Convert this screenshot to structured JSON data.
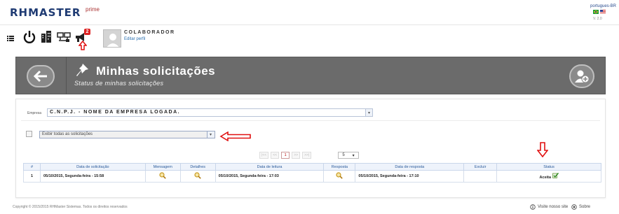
{
  "header": {
    "logo": "RHMASTER",
    "logo_sup": "prime",
    "language": "portugues-BR",
    "version": "V. 2.0"
  },
  "user": {
    "role": "COLABORADOR",
    "edit_profile": "Editar perfil"
  },
  "toolbar": {
    "notification_count": "2"
  },
  "banner": {
    "title": "Minhas solicitações",
    "subtitle": "Status de minhas solicitações"
  },
  "form": {
    "empresa_label": "Empresa",
    "empresa_value": "C.N.P.J. - NOME DA EMPRESA LOGADA.",
    "filter_value": "Exibir todas as solicitações"
  },
  "pager": {
    "current_page": "1",
    "page_size": "5"
  },
  "table": {
    "columns": [
      "#",
      "Data de solicitação",
      "Mensagem",
      "Detalhes",
      "Data de leitura",
      "Resposta",
      "Data de resposta",
      "Excluir",
      "Status"
    ],
    "rows": [
      {
        "num": "1",
        "data_solicitacao": "05/10/2015, Segunda-feira - 15:58",
        "data_leitura": "05/10/2015, Segunda-feira - 17:03",
        "data_resposta": "05/10/2015, Segunda-feira - 17:10",
        "status": "Aceita"
      }
    ]
  },
  "footer": {
    "copyright": "Copyright © 2015/2015 RHMaster Sistemas. Todos os direitos reservados",
    "tour": "Visite nosso site",
    "exit": "Sobre"
  },
  "colors": {
    "banner": "#6b6b6b",
    "accent_red": "#e01010",
    "header_text": "#2a5a9a"
  }
}
